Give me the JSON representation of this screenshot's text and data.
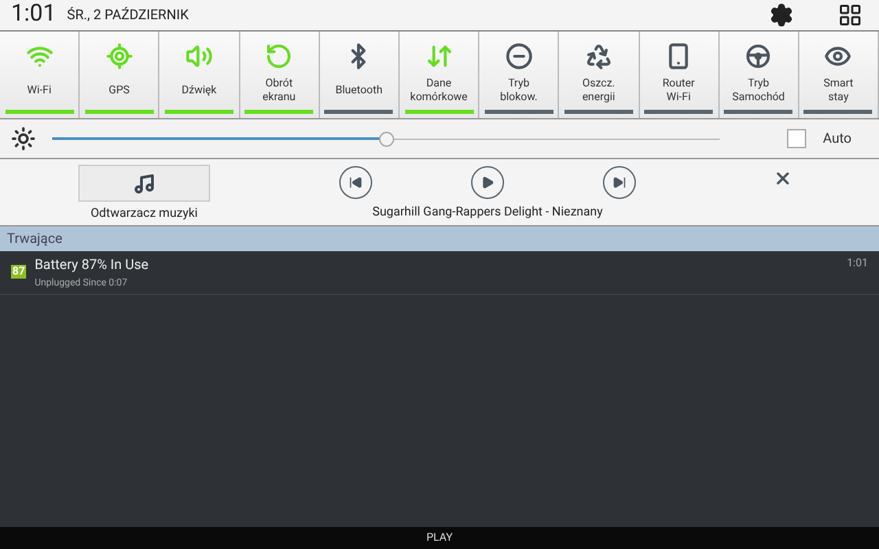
{
  "status_bar": {
    "time": "1:01",
    "date": "ŚR., 2 PAŹDZIERNIK"
  },
  "toggles": [
    {
      "kind": "wifi",
      "label": "Wi-Fi",
      "on": true
    },
    {
      "kind": "gps",
      "label": "GPS",
      "on": true
    },
    {
      "kind": "sound",
      "label": "Dźwięk",
      "on": true
    },
    {
      "kind": "rotate",
      "label": "Obrót\nekranu",
      "on": true
    },
    {
      "kind": "bluetooth",
      "label": "Bluetooth",
      "on": false
    },
    {
      "kind": "data",
      "label": "Dane\nkomórkowe",
      "on": true
    },
    {
      "kind": "block",
      "label": "Tryb\nblokow.",
      "on": false
    },
    {
      "kind": "power",
      "label": "Oszcz.\nenergii",
      "on": false
    },
    {
      "kind": "router",
      "label": "Router\nWi-Fi",
      "on": false
    },
    {
      "kind": "car",
      "label": "Tryb\nSamochód",
      "on": false
    },
    {
      "kind": "smart",
      "label": "Smart\nstay",
      "on": false
    }
  ],
  "brightness": {
    "level": 0.5,
    "auto_label": "Auto",
    "auto_checked": false
  },
  "music": {
    "app_label": "Odtwarzacz muzyki",
    "track": "Sugarhill Gang-Rappers Delight - Nieznany"
  },
  "section_header": "Trwające",
  "notifications": [
    {
      "badge": "87",
      "title": "Battery 87% In Use",
      "subtitle": "Unplugged Since 0:07",
      "time": "1:01"
    }
  ],
  "bottom_bar": {
    "label": "PLAY"
  }
}
